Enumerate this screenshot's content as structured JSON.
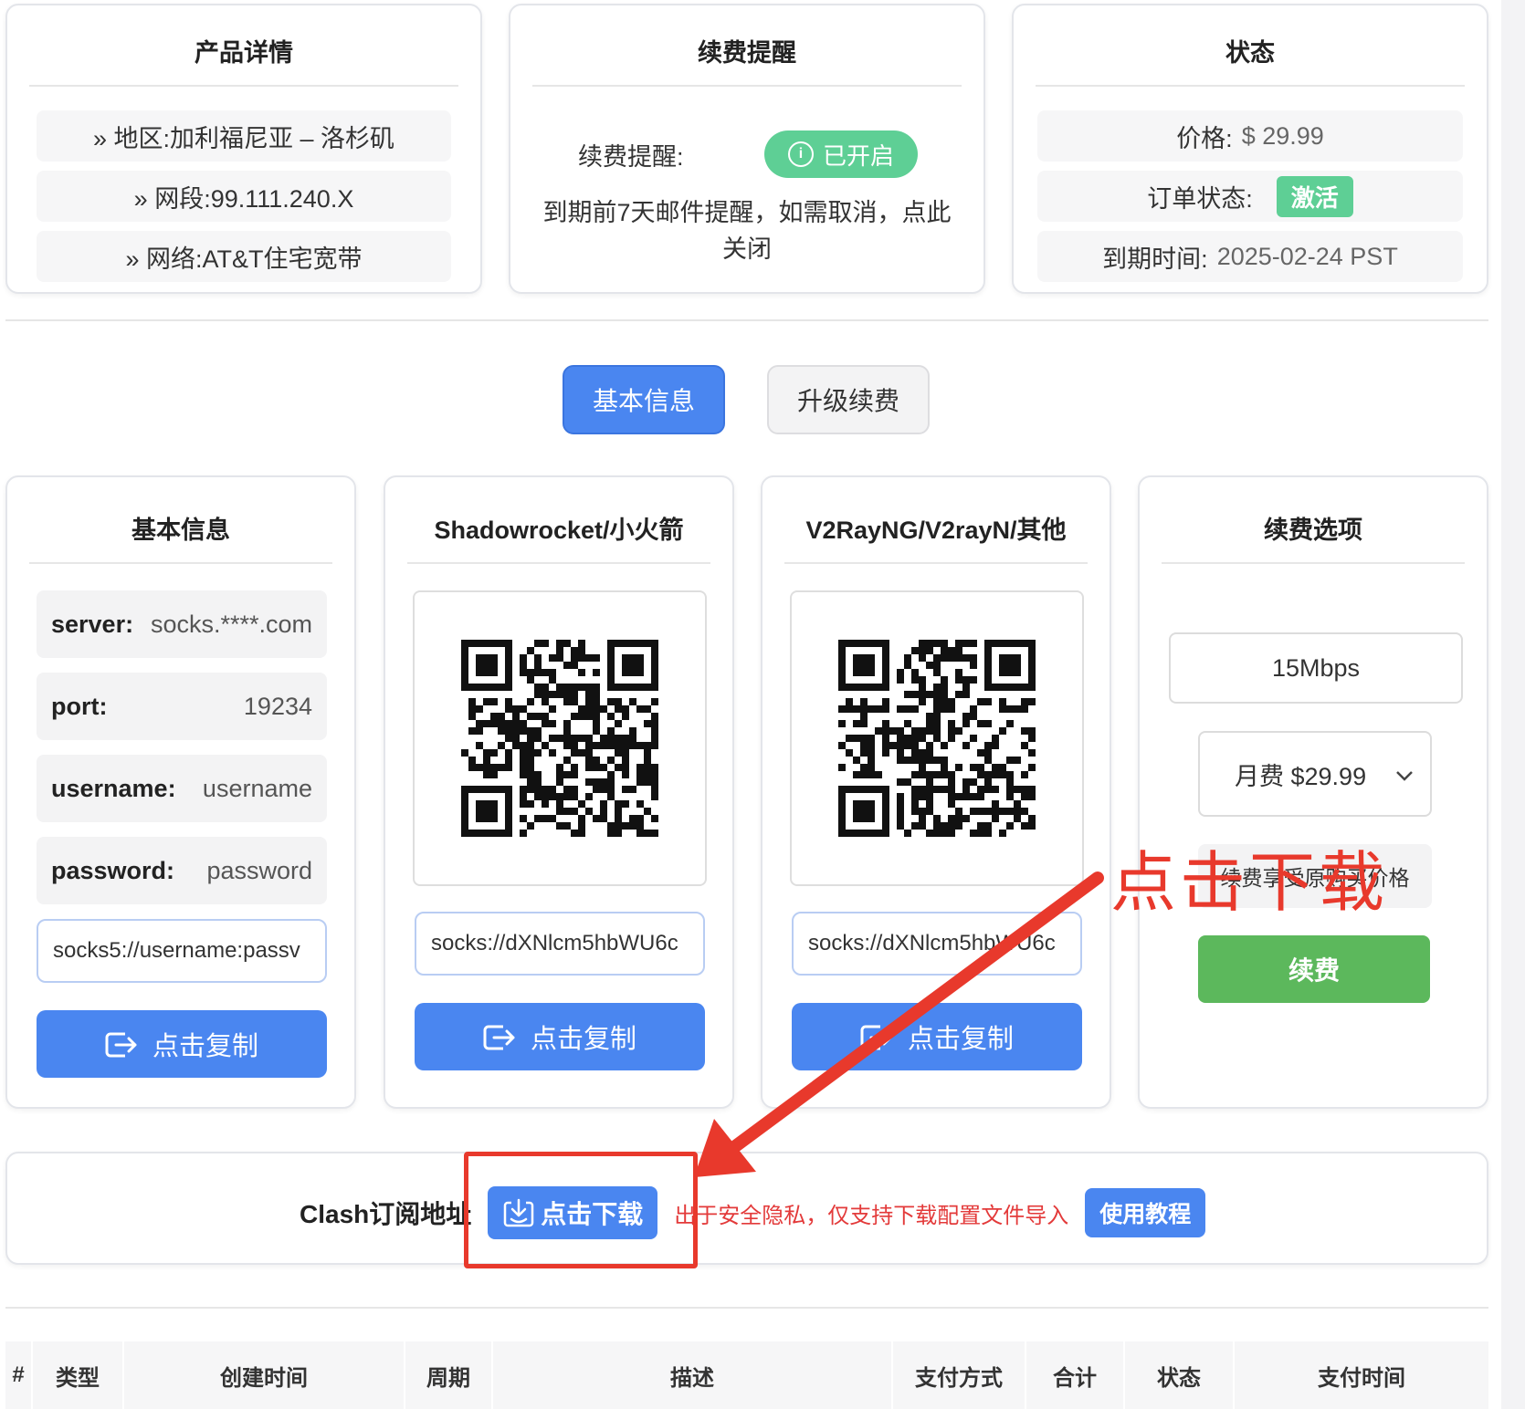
{
  "product_card": {
    "title": "产品详情",
    "rows": [
      "» 地区:加利福尼亚 – 洛杉矶",
      "» 网段:99.111.240.X",
      "» 网络:AT&T住宅宽带"
    ]
  },
  "renew_remind_card": {
    "title": "续费提醒",
    "label": "续费提醒:",
    "toggle_label": "已开启",
    "description": "到期前7天邮件提醒，如需取消，点此关闭"
  },
  "status_card": {
    "title": "状态",
    "price_label": "价格:",
    "price_value": "$ 29.99",
    "order_status_label": "订单状态:",
    "order_status_value": "激活",
    "expiry_label": "到期时间:",
    "expiry_value": "2025-02-24 PST"
  },
  "tabs": {
    "basic": "基本信息",
    "upgrade": "升级续费"
  },
  "basic_card": {
    "title": "基本信息",
    "server_key": "server:",
    "server_val": "socks.****.com",
    "port_key": "port:",
    "port_val": "19234",
    "username_key": "username:",
    "username_val": "username",
    "password_key": "password:",
    "password_val": "password",
    "link_value": "socks5://username:passv",
    "copy_label": "点击复制"
  },
  "shadowrocket_card": {
    "title": "Shadowrocket/小火箭",
    "link_value": "socks://dXNlcm5hbWU6c",
    "copy_label": "点击复制"
  },
  "v2ray_card": {
    "title": "V2RayNG/V2rayN/其他",
    "link_value": "socks://dXNlcm5hbWU6c",
    "copy_label": "点击复制"
  },
  "renew_option_card": {
    "title": "续费选项",
    "bandwidth_option": "15Mbps",
    "plan_option": "月费 $29.99",
    "note": "续费享受原购买价格",
    "renew_button": "续费"
  },
  "clash_card": {
    "label": "Clash订阅地址",
    "download_button": "点击下载",
    "note": "出于安全隐私，仅支持下载配置文件导入",
    "tutorial_button": "使用教程"
  },
  "table": {
    "headers": [
      "#",
      "类型",
      "创建时间",
      "周期",
      "描述",
      "支付方式",
      "合计",
      "状态",
      "支付时间"
    ]
  },
  "annotation": {
    "text": "点击下载",
    "color": "#e8392c"
  },
  "colors": {
    "primary": "#4a86f0",
    "success": "#5ecf95",
    "renew": "#5cb85c",
    "danger": "#e33a3a"
  }
}
